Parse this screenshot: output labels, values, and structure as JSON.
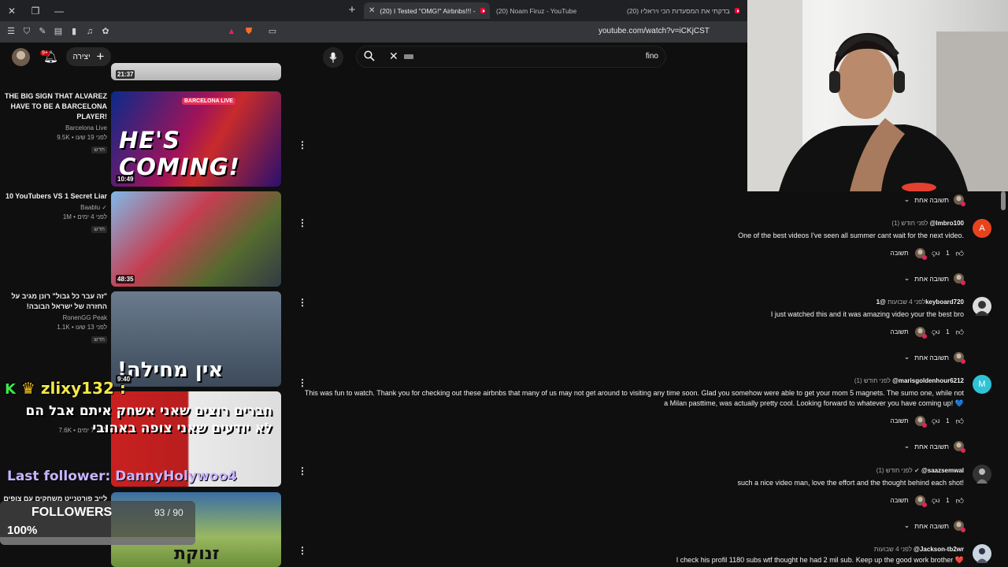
{
  "browser": {
    "tabs": [
      {
        "title": "(20) I Tested \"OMG!\" Airbnbs!!! -",
        "active": true
      },
      {
        "title": "(20) Noam Firuz - YouTube",
        "active": false
      },
      {
        "title": "(20) בדקתי את המסעדות הכי ויראליו",
        "active": false
      }
    ],
    "url": "youtube.com/watch?v=iCKjCST"
  },
  "header": {
    "notification_count": "9+",
    "create_label": "יצירה",
    "search_query": "fino"
  },
  "related": [
    {
      "title": "",
      "channel": "",
      "stats": "",
      "badge": "",
      "duration": "21:37"
    },
    {
      "title": "THE BIG SIGN THAT ALVAREZ HAVE TO BE A BARCELONA PLAYER!",
      "channel": "Barcelona Live",
      "stats": "9.5K • לפני 19 שעו",
      "badge": "חדש",
      "duration": "10:49",
      "thumb_text": "HE'S COMING!",
      "thumb_tag": "BARCELONA LIVE"
    },
    {
      "title": "10 YouTubers VS 1 Secret Liar",
      "channel": "Baablu",
      "stats": "1M • לפני 4 ימים",
      "badge": "חדש",
      "duration": "48:35"
    },
    {
      "title": "\"זה עבר כל גבול\" רונן מגיב על החזרה של ישראל הבובה!",
      "channel": "RonenGG Peak",
      "stats": "1.1K • לפני 13 שעו",
      "badge": "חדש",
      "duration": "9:40",
      "thumb_text": "אין מחילה!"
    },
    {
      "title": "",
      "channel": "",
      "stats": "7.6K • לפני 7 ימים",
      "badge": "",
      "duration": ""
    },
    {
      "title": "לייב פורטנייט משחקים עם צופים",
      "channel": "",
      "stats": "",
      "badge": "",
      "duration": "",
      "thumb_text": "זנוקת"
    }
  ],
  "overlay": {
    "chat_user": "zlixy132 :",
    "chat_message": "חברים רוצים שאני אשחק איתם אבל הם לא יודעים שאני צופה באהובי",
    "last_follower": "Last follower: DannyHolywoo4",
    "goal_title": "FOLLOWERS",
    "goal_count": "93 / 90",
    "goal_percent": "100%",
    "goal_progress": 1.0
  },
  "comments": [
    {
      "replies": "תשובה אחת"
    },
    {
      "handle": "@lmbro100",
      "time": "לפני חודש (1)",
      "text": "One of the best videos I've seen all summer cant wait for the next video.",
      "likes": "1",
      "reply_label": "תשובה",
      "replies": "תשובה אחת",
      "avatar_letter": "A",
      "avatar_color": "#e8431d"
    },
    {
      "handle": "@1keyboard720",
      "time": "לפני 4 שבועות",
      "text": "I just watched this and it was amazing video your the best bro",
      "likes": "1",
      "reply_label": "תשובה",
      "replies": "תשובה אחת",
      "avatar_letter": "",
      "avatar_color": "#777"
    },
    {
      "handle": "@marisgoldenhour6212",
      "time": "לפני חודש (1)",
      "text": "This was fun to watch.  Thank you for checking out these airbnbs that many of us may not get around to visiting any time soon.  Glad you somehow were able to get your mom 5 magnets.  The sumo one, while not a Milan pasttime, was actually pretty cool. Looking forward to whatever you have coming up! 💙",
      "likes": "1",
      "reply_label": "תשובה",
      "replies": "תשובה אחת",
      "avatar_letter": "M",
      "avatar_color": "#2ec4d6"
    },
    {
      "handle": "@saazsemwal",
      "time": "לפני חודש (1)",
      "text": "such a nice video man, love the effort and the thought behind each shot!",
      "likes": "1",
      "reply_label": "תשובה",
      "replies": "תשובה אחת",
      "avatar_letter": "",
      "avatar_color": "#555"
    },
    {
      "handle": "@Jackson-tb2wr",
      "time": "לפני 4 שבועות",
      "text": "I check his profil 1180 subs wtf thought he had 2 mil sub. Keep up the good work brother ❤️",
      "likes": "",
      "reply_label": "",
      "replies": "",
      "avatar_letter": "",
      "avatar_color": "#888"
    }
  ],
  "colors": {
    "background": "#0f0f0f",
    "accent": "#ff0033"
  }
}
